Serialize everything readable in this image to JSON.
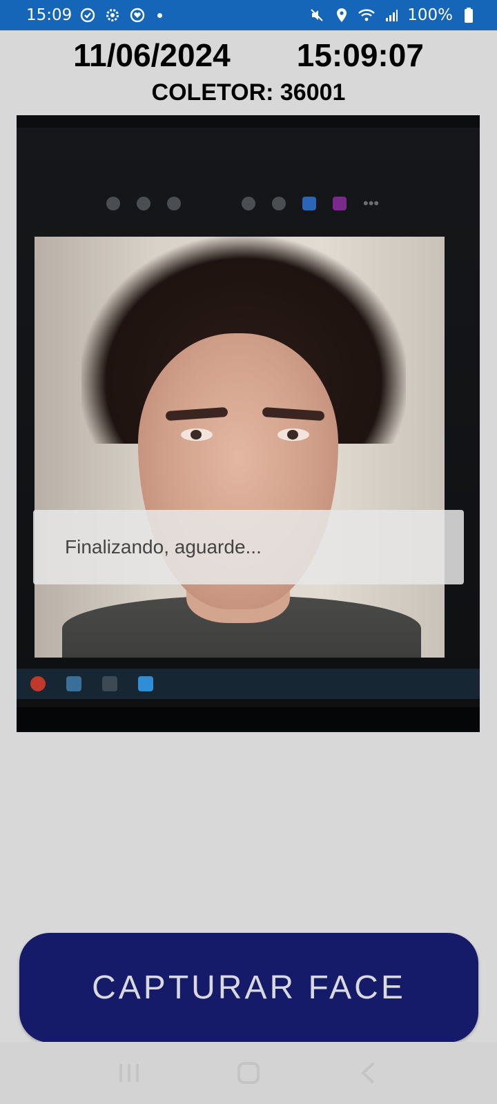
{
  "status_bar": {
    "time": "15:09",
    "battery": "100%",
    "left_icons": [
      "sync-icon",
      "settings-icon",
      "heart-monitor-icon",
      "notification-dot-icon"
    ],
    "right_icons": [
      "mute-vibrate-icon",
      "location-icon",
      "wifi-icon",
      "signal-icon",
      "battery-icon"
    ]
  },
  "header": {
    "date": "11/06/2024",
    "time": "15:09:07",
    "collector_label": "COLETOR: 36001"
  },
  "camera": {
    "toast_message": "Finalizando, aguarde..."
  },
  "actions": {
    "capture_label": "CAPTURAR FACE"
  },
  "nav_bar": {
    "buttons": [
      "recent-apps-icon",
      "home-icon",
      "back-icon"
    ]
  },
  "colors": {
    "status_bar": "#1565b8",
    "background": "#d8d8d8",
    "button": "#161b69",
    "button_text": "#d9d9e0"
  }
}
